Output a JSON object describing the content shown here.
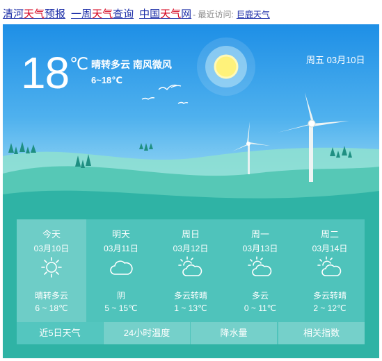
{
  "topbar": {
    "links": [
      {
        "pre": "清河",
        "red": "天气",
        "post": "预报"
      },
      {
        "pre": "一周",
        "red": "天气",
        "post": "查询"
      },
      {
        "pre": "中国",
        "red": "天气",
        "post": "网"
      }
    ],
    "recent_label": "- 最近访问:",
    "recent_link": "巨鹿天气"
  },
  "current": {
    "temp": "18",
    "unit": "℃",
    "condition": "晴转多云 南风微风",
    "range": "6~18℃",
    "date": "周五 03月10日"
  },
  "forecast": [
    {
      "name": "今天",
      "date": "03月10日",
      "icon": "sun-icon",
      "desc": "晴转多云",
      "range": "6 ~ 18℃"
    },
    {
      "name": "明天",
      "date": "03月11日",
      "icon": "cloud-icon",
      "desc": "阴",
      "range": "5 ~ 15℃"
    },
    {
      "name": "周日",
      "date": "03月12日",
      "icon": "partly-cloudy-icon",
      "desc": "多云转晴",
      "range": "1 ~ 13℃"
    },
    {
      "name": "周一",
      "date": "03月13日",
      "icon": "partly-cloudy-icon",
      "desc": "多云",
      "range": "0 ~ 11℃"
    },
    {
      "name": "周二",
      "date": "03月14日",
      "icon": "partly-cloudy-icon",
      "desc": "多云转晴",
      "range": "2 ~ 12℃"
    }
  ],
  "tabs": [
    "近5日天气",
    "24小时温度",
    "降水量",
    "相关指数"
  ],
  "colors": {
    "link": "#1d2fa8",
    "highlight": "#d6001c",
    "sky": "#1e8fe6",
    "hills": "#2bb3a7"
  }
}
